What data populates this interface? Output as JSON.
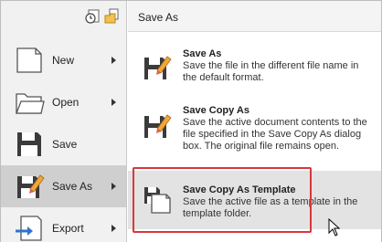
{
  "menu": {
    "items": [
      {
        "label": "New",
        "icon": "new-document-icon"
      },
      {
        "label": "Open",
        "icon": "open-folder-icon"
      },
      {
        "label": "Save",
        "icon": "floppy-disk-icon"
      },
      {
        "label": "Save As",
        "icon": "save-as-icon"
      },
      {
        "label": "Export",
        "icon": "export-icon"
      }
    ]
  },
  "panel": {
    "title": "Save As",
    "entries": [
      {
        "title": "Save As",
        "description": "Save the file in the different file name in the default format."
      },
      {
        "title": "Save Copy As",
        "description": "Save the active document contents to the file specified in the Save Copy As dialog box. The original file remains open."
      },
      {
        "title": "Save Copy As Template",
        "description": "Save the active file as a template in the template folder."
      }
    ]
  },
  "colors": {
    "highlight_border": "#d9373b",
    "active_item": "#cfcfcf"
  }
}
